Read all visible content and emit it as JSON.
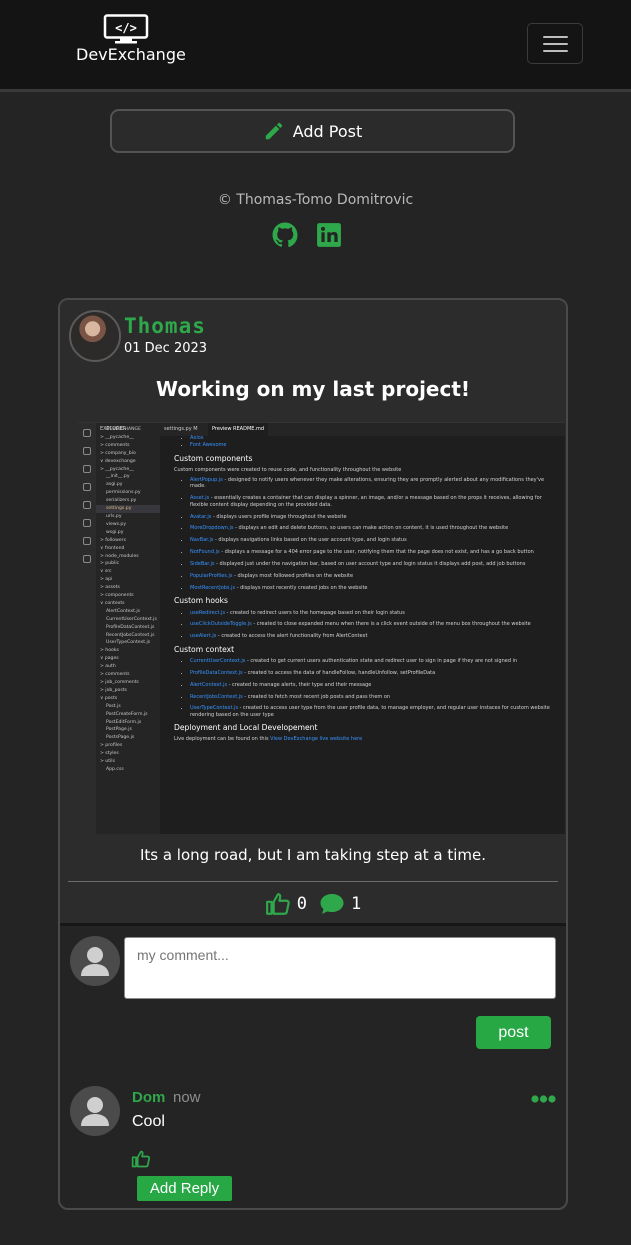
{
  "nav": {
    "brand_name": "DevExchange",
    "logo_text": "</>"
  },
  "add_post": {
    "label": "Add Post"
  },
  "footer": {
    "copyright": "© Thomas-Tomo Domitrovic",
    "icons": [
      "github-icon",
      "linkedin-icon"
    ]
  },
  "post": {
    "author": "Thomas",
    "date": "01 Dec 2023",
    "title": "Working on my last project!",
    "caption": "Its a long road, but I am taking step at a time.",
    "likes": "0",
    "comments": "1",
    "screenshot": {
      "tabs": [
        "EXPLORER",
        "settings.py M",
        "Preview README.md"
      ],
      "explorer": [
        "DEVEXCHANGE",
        "> __pycache__",
        "> comments",
        "> company_bio",
        "∨ devexchange",
        "> __pycache__",
        "__init__.py",
        "asgi.py",
        "permissions.py",
        "serializers.py",
        "settings.py",
        "urls.py",
        "views.py",
        "wsgi.py",
        "> followers",
        "∨ frontend",
        "> node_modules",
        "> public",
        "∨ src",
        "> api",
        "> assets",
        "> components",
        "∨ contexts",
        "AlertContext.js",
        "CurrentUserContext.js",
        "ProfileDataContext.js",
        "RecentJobsContext.js",
        "UserTypeContext.js",
        "> hooks",
        "∨ pages",
        "> auth",
        "> comments",
        "> job_comments",
        "> job_posts",
        "∨ posts",
        "Post.js",
        "PostCreateForm.js",
        "PostEditForm.js",
        "PostPage.js",
        "PostsPage.js",
        "> profiles",
        "> styles",
        "> utils",
        "App.css"
      ],
      "sections": [
        {
          "heading": "",
          "intro": "",
          "items": [
            {
              "link": "Axios",
              "text": ""
            },
            {
              "link": "Font Awesome",
              "text": ""
            }
          ]
        },
        {
          "heading": "Custom components",
          "intro": "Custom components were created to reuse code, and functionality throughout the website",
          "items": [
            {
              "link": "AlertPopup.js",
              "text": " - designed to notify users whenever they make alterations, ensuring they are promptly alerted about any modifications they've made."
            },
            {
              "link": "Asset.js",
              "text": " - essentially creates a container that can display a spinner, an image, and/or a message based on the props it receives, allowing for flexible content display depending on the provided data."
            },
            {
              "link": "Avatar.js",
              "text": " - displays users profile image throughout the website"
            },
            {
              "link": "MoreDropdown.js",
              "text": " - displays an edit and delete buttons, so users can make action on content, it is used throughout the website"
            },
            {
              "link": "NavBar.js",
              "text": " - displays navigations links based on the user account type, and login status"
            },
            {
              "link": "NotFound.js",
              "text": " - displays a message for a 404 error page to the user, notifying them that the page does not exist, and has a go back button"
            },
            {
              "link": "SideBar.js",
              "text": " - displayed just under the navigation bar, based on user account type and login status it displays add post, add job buttons"
            },
            {
              "link": "PopularProfiles.js",
              "text": " - displays most followed profiles on the website"
            },
            {
              "link": "MostRecentJobs.js",
              "text": " - displays most recently created jobs on the website"
            }
          ]
        },
        {
          "heading": "Custom hooks",
          "intro": "",
          "items": [
            {
              "link": "useRedirect.js",
              "text": " - created to redirect users to the homepage based on their login status"
            },
            {
              "link": "useClickOutsideToggle.js",
              "text": " - created to close expanded menu when there is a click event outside of the menu box throughout the website"
            },
            {
              "link": "useAlert.js",
              "text": " - created to access the alert functionality from AlertContext"
            }
          ]
        },
        {
          "heading": "Custom context",
          "intro": "",
          "items": [
            {
              "link": "CurrentUserContext.js",
              "text": " - created to get current users authentication state and redirect user to sign in page if they are not signed in"
            },
            {
              "link": "ProfileDataContext.js",
              "text": " - created to access the data of handleFollow, handleUnfollow, setProfileData"
            },
            {
              "link": "AlertContext.js",
              "text": " - created to manage alerts, their type and their message"
            },
            {
              "link": "RecentJobsContext.js",
              "text": " - created to fetch most recent job posts and pass them on"
            },
            {
              "link": "UserTypeContext.js",
              "text": " - created to access user type from the user profile data, to manage employer, and regular user instaces for custom website rendering based on the user type"
            }
          ]
        },
        {
          "heading": "Deployment and Local Developement",
          "intro": "",
          "items": []
        }
      ],
      "deploy_text": "Live deployment can be found on this ",
      "deploy_link": "View DevExchange live website here"
    }
  },
  "comment_form": {
    "placeholder": "my comment...",
    "submit_label": "post"
  },
  "comments": [
    {
      "author": "Dom",
      "time": "now",
      "text": "Cool",
      "reply_label": "Add Reply"
    }
  ],
  "colors": {
    "accent": "#28a745",
    "nav_bg": "#141414",
    "page_bg": "#242424",
    "card_bg": "#2c2c2c"
  }
}
